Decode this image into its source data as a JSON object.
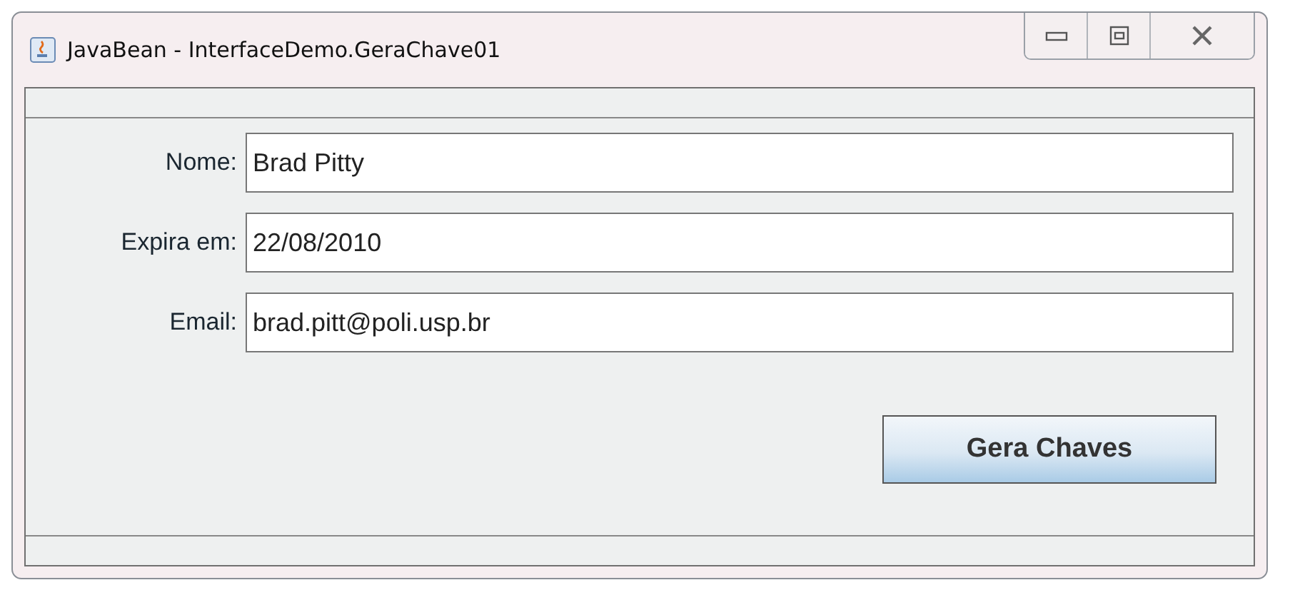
{
  "window": {
    "title": "JavaBean - InterfaceDemo.GeraChave01"
  },
  "fields": [
    {
      "label": "Nome:",
      "value": "Brad Pitty"
    },
    {
      "label": "Expira em:",
      "value": "22/08/2010"
    },
    {
      "label": "Email:",
      "value": "brad.pitt@poli.usp.br"
    }
  ],
  "buttons": [
    "Gera Chaves"
  ]
}
